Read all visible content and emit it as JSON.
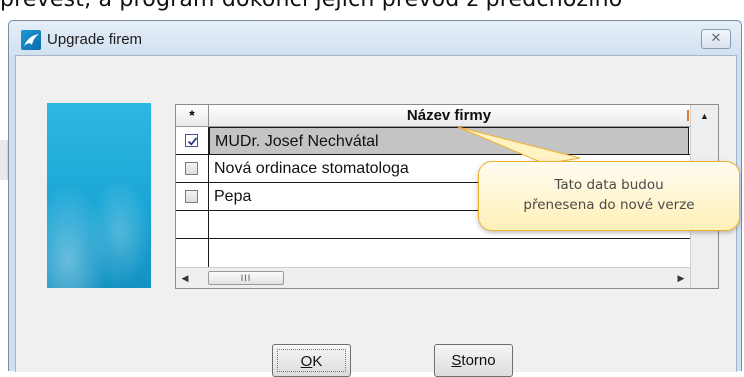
{
  "background_text": "převést, a program dokončí jejich převod z předchozího",
  "window": {
    "title": "Upgrade firem",
    "close_icon": "close-icon"
  },
  "grid": {
    "columns": [
      "*",
      "Název firmy"
    ],
    "rows": [
      {
        "checked": true,
        "name": "MUDr. Josef Nechvátal",
        "selected": true
      },
      {
        "checked": false,
        "name": "Nová ordinace stomatologa",
        "selected": false
      },
      {
        "checked": false,
        "name": "Pepa",
        "selected": false
      }
    ],
    "scroll_thumb": "III"
  },
  "buttons": {
    "ok_mnemonic": "O",
    "ok_rest": "K",
    "storno_mnemonic": "S",
    "storno_rest": "torno"
  },
  "tooltip": {
    "line1": "Tato data budou",
    "line2": "přenesena do nové verze"
  },
  "colors": {
    "accent": "#1aa6d6",
    "tooltip_border": "#f0b02e",
    "selection": "#c4c4c4"
  }
}
